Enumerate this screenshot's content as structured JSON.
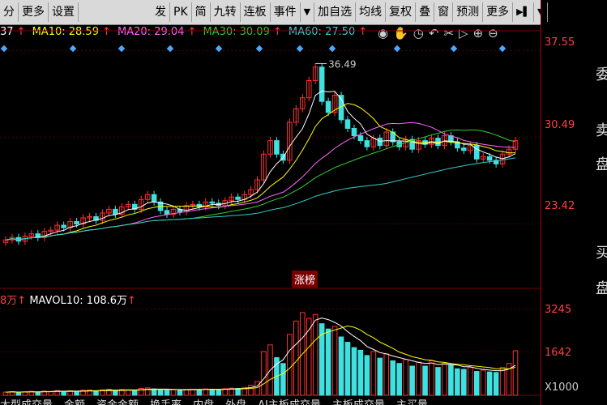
{
  "toolbar": {
    "items": [
      "分",
      "更多",
      "设置",
      "发",
      "PK",
      "简",
      "九转",
      "连板",
      "事件",
      "加自选",
      "均线",
      "复权",
      "叠",
      "窗",
      "预测",
      "更多"
    ]
  },
  "indicators": {
    "first": "37",
    "ma10": "MA10: 28.59",
    "ma20": "MA20: 29.04",
    "ma30": "MA30: 30.09",
    "ma60": "MA60: 27.50",
    "vol_prefix": "8万",
    "mavol10": "MAVOL10: 108.6万"
  },
  "price_axis": [
    "37.55",
    "30.49",
    "23.42"
  ],
  "volume_axis": [
    "3245",
    "1642",
    "X1000"
  ],
  "high_marker": "36.49",
  "badge": "涨榜",
  "side_labels": [
    "委",
    "卖",
    "盘",
    "买",
    "盘"
  ],
  "bottom_tabs": [
    "大型成交量",
    "金额",
    "资金金额",
    "换手率",
    "内盘",
    "外盘",
    "AI主板成交量",
    "主板成交量",
    "主买量"
  ],
  "colors": {
    "up": "#ff3030",
    "down": "#3fe0e0",
    "ma5": "#ffffff",
    "ma10": "#ffff00",
    "ma20": "#ff66ff",
    "ma30": "#33cc33",
    "ma60": "#33cccc"
  },
  "chart_data": {
    "type": "candlestick",
    "y_range": [
      20.0,
      38.5
    ],
    "close": [
      22.1,
      22.3,
      22.0,
      22.4,
      22.6,
      22.3,
      22.8,
      22.9,
      23.3,
      23.1,
      23.6,
      23.4,
      23.9,
      24.0,
      23.7,
      24.3,
      24.6,
      24.2,
      24.8,
      25.0,
      24.6,
      25.4,
      25.8,
      25.2,
      24.5,
      24.2,
      24.6,
      24.4,
      24.9,
      25.0,
      24.8,
      25.2,
      25.1,
      24.9,
      25.3,
      25.6,
      25.4,
      25.8,
      26.2,
      27.0,
      29.1,
      30.2,
      29.1,
      28.6,
      31.7,
      32.8,
      33.7,
      35.1,
      36.2,
      33.4,
      32.5,
      33.9,
      31.9,
      31.2,
      30.6,
      30.2,
      29.7,
      30.4,
      29.8,
      30.9,
      30.1,
      29.7,
      30.3,
      29.5,
      30.2,
      29.9,
      30.4,
      29.8,
      30.6,
      30.1,
      29.6,
      29.4,
      29.8,
      28.7,
      28.9,
      28.6,
      28.3,
      29.1,
      29.5,
      30.2
    ],
    "volume": [
      120,
      140,
      110,
      130,
      150,
      120,
      160,
      145,
      180,
      150,
      170,
      140,
      190,
      200,
      160,
      210,
      230,
      180,
      220,
      200,
      190,
      260,
      280,
      240,
      200,
      190,
      210,
      200,
      220,
      230,
      210,
      240,
      230,
      220,
      250,
      270,
      260,
      300,
      380,
      520,
      1650,
      1900,
      1420,
      1200,
      2300,
      2800,
      3120,
      2900,
      3050,
      2700,
      2500,
      2600,
      2200,
      2000,
      1800,
      1700,
      1500,
      1650,
      1400,
      1560,
      1300,
      1200,
      1350,
      1100,
      1250,
      1100,
      1300,
      1050,
      1200,
      1150,
      1000,
      980,
      1050,
      900,
      950,
      880,
      860,
      1050,
      1200,
      1680
    ],
    "xlabel": "",
    "ylabel": ""
  }
}
